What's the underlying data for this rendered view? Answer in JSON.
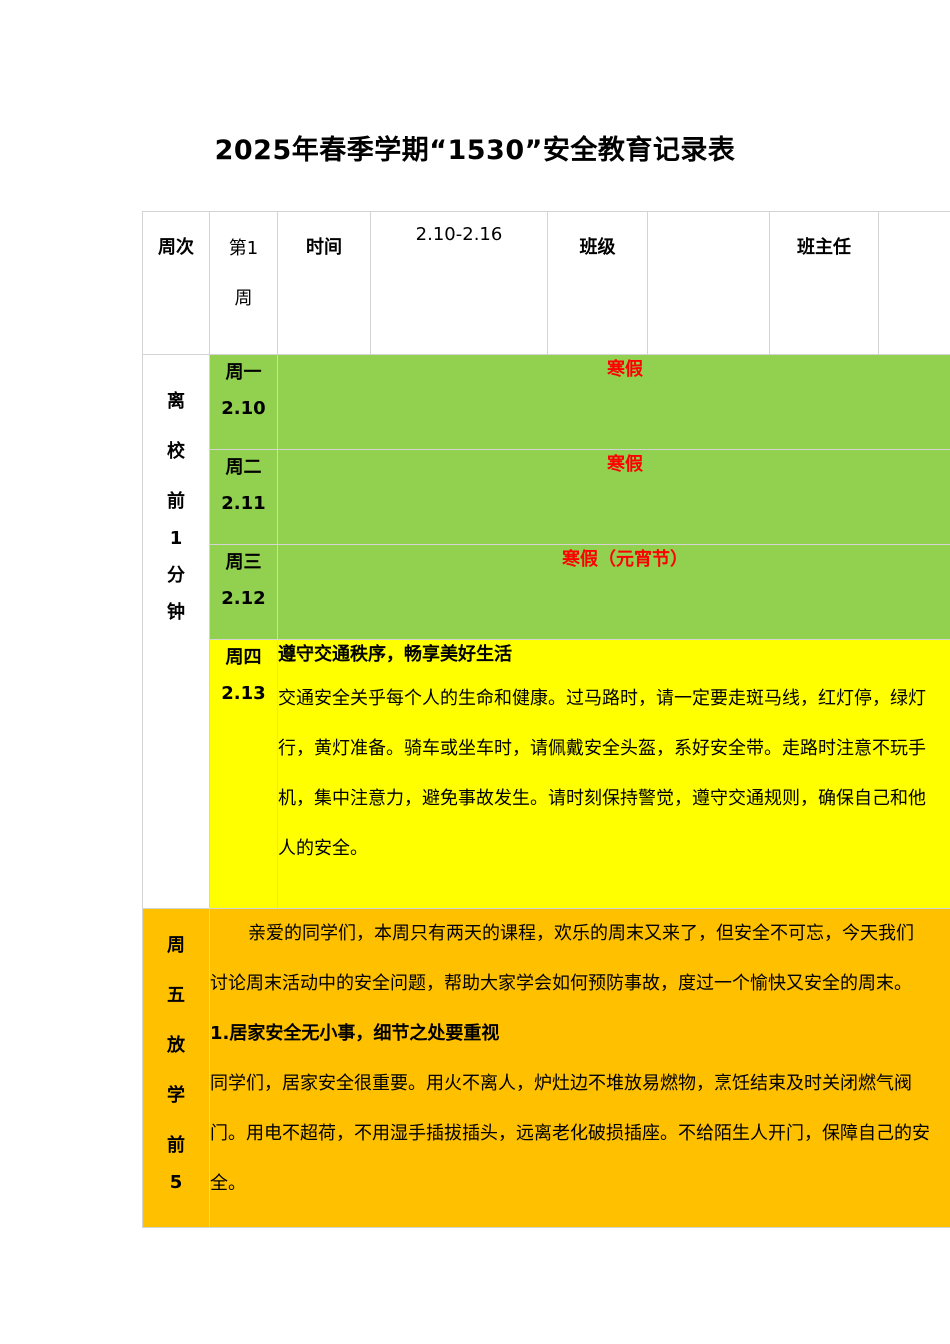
{
  "title": "2025年春季学期“1530”安全教育记录表",
  "header": {
    "week_label": "周次",
    "week_value_line1": "第1",
    "week_value_line2": "周",
    "time_label": "时间",
    "time_value": "2.10-2.16",
    "class_label": "班级",
    "class_value": "",
    "teacher_label": "班主任",
    "teacher_value": ""
  },
  "section1": {
    "chars": [
      "离",
      "校",
      "前",
      "1",
      "分",
      "钟"
    ]
  },
  "days": [
    {
      "name": "周一",
      "date": "2.10",
      "text": "寒假"
    },
    {
      "name": "周二",
      "date": "2.11",
      "text": "寒假"
    },
    {
      "name": "周三",
      "date": "2.12",
      "text": "寒假（元宵节）"
    }
  ],
  "thursday": {
    "name": "周四",
    "date": "2.13",
    "heading": "遵守交通秩序，畅享美好生活",
    "lines": [
      "交通安全关乎每个人的生命和健康。过马路时，请一定要走斑马线，红灯停，绿灯",
      "行，黄灯准备。骑车或坐车时，请佩戴安全头盔，系好安全带。走路时注意不玩手",
      "机，集中注意力，避免事故发生。请时刻保持警觉，遵守交通规则，确保自己和他",
      "人的安全。"
    ]
  },
  "section2": {
    "chars": [
      "周",
      "五",
      "放",
      "学",
      "前",
      "5"
    ]
  },
  "friday": {
    "intro_lines": [
      "亲爱的同学们，本周只有两天的课程，欢乐的周末又来了，但安全不可忘，今天我们",
      "讨论周末活动中的安全问题，帮助大家学会如何预防事故，度过一个愉快又安全的周末。"
    ],
    "heading": "1.居家安全无小事，细节之处要重视",
    "lines": [
      "同学们，居家安全很重要。用火不离人，炉灶边不堆放易燃物，烹饪结束及时关闭燃气阀",
      "门。用电不超荷，不用湿手插拔插头，远离老化破损插座。不给陌生人开门，保障自己的安",
      "全。"
    ]
  }
}
